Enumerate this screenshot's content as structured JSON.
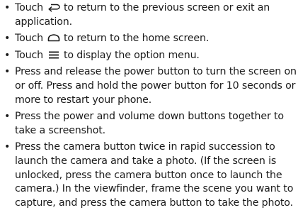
{
  "bullet_glyph": "•",
  "items": [
    {
      "icon": "back-icon",
      "before_icon": "Touch",
      "after_icon": "to return to the previous screen or exit an application."
    },
    {
      "icon": "home-icon",
      "before_icon": "Touch",
      "after_icon": "to return to the home screen."
    },
    {
      "icon": "menu-icon",
      "before_icon": "Touch",
      "after_icon": "to display the option menu."
    },
    {
      "text": "Press and release the power button to turn the screen on or off. Press and hold the power button for 10 seconds or more to restart your phone."
    },
    {
      "text": "Press the power and volume down buttons together to take a screenshot."
    },
    {
      "text": "Press the camera button twice in rapid succession to launch the camera and take a photo. (If the screen is unlocked, press the camera button once to launch the camera.) In the viewfinder, frame the scene you want to capture, and press the camera button to take the photo."
    }
  ]
}
